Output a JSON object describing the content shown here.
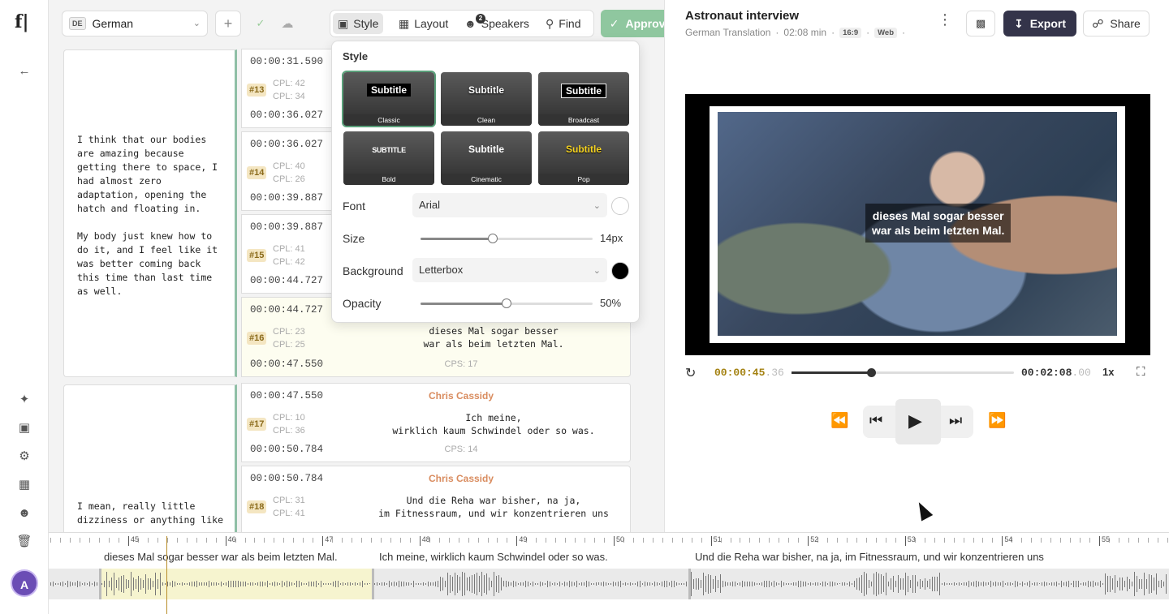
{
  "app": {
    "logo": "f|",
    "avatar_initial": "A"
  },
  "toolbar": {
    "language_code": "DE",
    "language_name": "German",
    "tabs": [
      {
        "label": "Style",
        "icon": "text-style-icon",
        "active": true
      },
      {
        "label": "Layout",
        "icon": "grid-icon",
        "active": false
      },
      {
        "label": "Speakers",
        "icon": "speakers-icon",
        "badge": "2",
        "active": false
      },
      {
        "label": "Find",
        "icon": "search-icon",
        "active": false
      }
    ],
    "approve_label": "Approve"
  },
  "style_panel": {
    "title": "Style",
    "presets": [
      {
        "name": "Classic",
        "sample": "Subtitle",
        "selected": true
      },
      {
        "name": "Clean",
        "sample": "Subtitle",
        "selected": false
      },
      {
        "name": "Broadcast",
        "sample": "Subtitle",
        "selected": false
      },
      {
        "name": "Bold",
        "sample": "SUBTITLE",
        "selected": false
      },
      {
        "name": "Cinematic",
        "sample": "Subtitle",
        "selected": false
      },
      {
        "name": "Pop",
        "sample": "Subtitle",
        "selected": false
      }
    ],
    "font_label": "Font",
    "font_value": "Arial",
    "font_color": "#ffffff",
    "size_label": "Size",
    "size_value": "14px",
    "size_fraction": 0.42,
    "background_label": "Background",
    "background_value": "Letterbox",
    "background_color": "#000000",
    "opacity_label": "Opacity",
    "opacity_value": "50%",
    "opacity_fraction": 0.5
  },
  "source_blocks": [
    {
      "text": "I think that our bodies are amazing because getting there to space, I had almost zero adaptation, opening the hatch and floating in.\n\nMy body just knew how to do it, and I feel like it was better coming back this time than last time as well."
    },
    {
      "text": "I mean, really little dizziness or anything like"
    }
  ],
  "segments": [
    {
      "number": "#13",
      "in": "00:00:31.590",
      "out": "00:00:36.027",
      "cpl1": "CPL: 42",
      "cpl2": "CPL: 34"
    },
    {
      "number": "#14",
      "in": "00:00:36.027",
      "out": "00:00:39.887",
      "cpl1": "CPL: 40",
      "cpl2": "CPL: 26"
    },
    {
      "number": "#15",
      "in": "00:00:39.887",
      "out": "00:00:44.727",
      "cpl1": "CPL: 41",
      "cpl2": "CPL: 42"
    },
    {
      "number": "#16",
      "in": "00:00:44.727",
      "out": "00:00:47.550",
      "cpl1": "CPL: 23",
      "cpl2": "CPL: 25",
      "text": "dieses Mal sogar besser\nwar als beim letzten Mal.",
      "cps": "CPS: 17"
    },
    {
      "number": "#17",
      "in": "00:00:47.550",
      "out": "00:00:50.784",
      "cpl1": "CPL: 10",
      "cpl2": "CPL: 36",
      "speaker": "Chris Cassidy",
      "text": "Ich meine,\nwirklich kaum Schwindel oder so was.",
      "cps": "CPS: 14"
    },
    {
      "number": "#18",
      "in": "00:00:50.784",
      "cpl1": "CPL: 31",
      "cpl2": "CPL: 41",
      "speaker": "Chris Cassidy",
      "text": "Und die Reha war bisher, na ja,\nim Fitnessraum, und wir konzentrieren uns"
    }
  ],
  "project": {
    "title": "Astronaut interview",
    "subtitle": "German Translation",
    "duration": "02:08 min",
    "aspect": "16:9",
    "platform": "Web",
    "export_label": "Export",
    "share_label": "Share"
  },
  "player": {
    "subtitle_text": "dieses Mal sogar besser\nwar als beim letzten Mal.",
    "current_main": "00:00:45",
    "current_frac": ".36",
    "duration_main": "00:02:08",
    "duration_frac": ".00",
    "progress_fraction": 0.357,
    "speed": "1x"
  },
  "timeline": {
    "ticks": [
      "45",
      "46",
      "47",
      "48",
      "49",
      "50",
      "51",
      "52",
      "53",
      "54",
      "55"
    ],
    "captions": [
      "dieses Mal sogar besser war als beim letzten Mal.",
      "Ich meine, wirklich kaum Schwindel oder so was.",
      "Und die Reha war bisher, na ja, im Fitnessraum, und wir konzentrieren uns"
    ]
  }
}
